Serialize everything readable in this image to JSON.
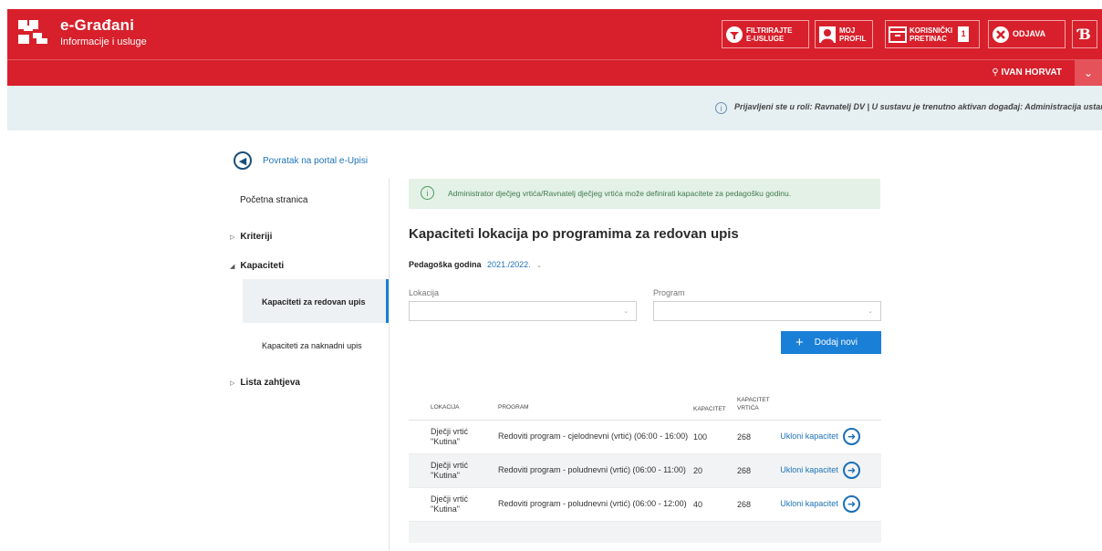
{
  "header": {
    "brand_title": "e-Građani",
    "brand_sub": "Informacije i usluge",
    "filter_label_1": "FILTRIRAJTE",
    "filter_label_2": "E-USLUGE",
    "profile_label_1": "MOJ",
    "profile_label_2": "PROFIL",
    "inbox_label_1": "KORISNIČKI",
    "inbox_label_2": "PRETINAC",
    "inbox_count": "1",
    "logout_label": "ODJAVA",
    "accent_color": "#d7202b"
  },
  "userbar": {
    "user_name": "IVAN HORVAT"
  },
  "info": {
    "role_text": "Prijavljeni ste u roli: Ravnatelj DV | U sustavu je trenutno aktivan događaj: Administracija ustanova"
  },
  "sidebar": {
    "back_label": "Povratak na portal e-Upisi",
    "home": "Početna stranica",
    "criteria": "Kriteriji",
    "capacities": "Kapaciteti",
    "sub_regular": "Kapaciteti za redovan upis",
    "sub_late": "Kapaciteti za naknadni upis",
    "requests": "Lista zahtjeva"
  },
  "main": {
    "alert_text": "Administrator dječjeg vrtića/Ravnatelj dječjeg vrtića može definirati kapacitete za pedagošku godinu.",
    "title": "Kapaciteti lokacija po programima za redovan upis",
    "year_label": "Pedagoška godina",
    "year_value": "2021./2022.",
    "location_label": "Lokacija",
    "program_label": "Program",
    "add_button": "Dodaj novi"
  },
  "table": {
    "headers": [
      "LOKACIJA",
      "PROGRAM",
      "KAPACITET",
      "KAPACITET VRTIĆA"
    ],
    "rows": [
      {
        "location": "Dječji vrtić \"Kutina\"",
        "program": "Redoviti program - cjelodnevni (vrtić) (06:00 - 16:00)",
        "capacity": "100",
        "kindergarten_capacity": "268",
        "action": "Ukloni kapacitet"
      },
      {
        "location": "Dječji vrtić \"Kutina\"",
        "program": "Redoviti program - poludnevni (vrtić) (06:00 - 11:00)",
        "capacity": "20",
        "kindergarten_capacity": "268",
        "action": "Ukloni kapacitet"
      },
      {
        "location": "Dječji vrtić \"Kutina\"",
        "program": "Redoviti program - poludnevni (vrtić) (06:00 - 12:00)",
        "capacity": "40",
        "kindergarten_capacity": "268",
        "action": "Ukloni kapacitet"
      }
    ]
  }
}
